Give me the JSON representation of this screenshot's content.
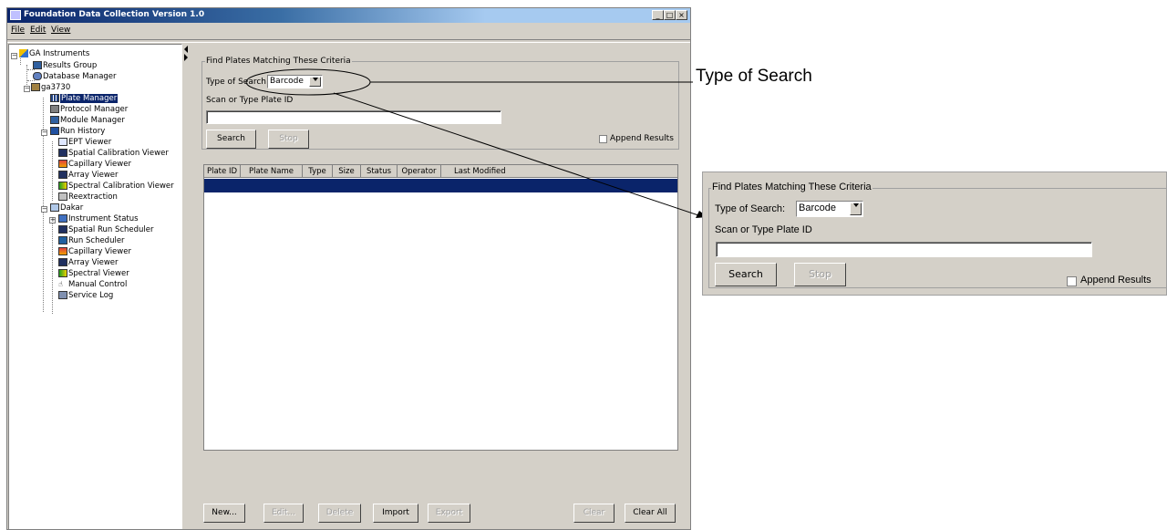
{
  "window": {
    "title": "Foundation Data Collection Version 1.0",
    "controls": [
      "_",
      "□",
      "×"
    ]
  },
  "menu": [
    "File",
    "Edit",
    "View"
  ],
  "tree": {
    "root": "GA Instruments",
    "items": [
      {
        "label": "Results Group",
        "icon": "results-group-icon"
      },
      {
        "label": "Database Manager",
        "icon": "database-icon"
      },
      {
        "label": "ga3730",
        "icon": "instrument-icon"
      },
      {
        "label": "Plate Manager",
        "icon": "grid-icon",
        "selected": true
      },
      {
        "label": "Protocol Manager",
        "icon": "protocol-icon"
      },
      {
        "label": "Module Manager",
        "icon": "module-icon"
      },
      {
        "label": "Run History",
        "icon": "run-history-icon"
      },
      {
        "label": "EPT Viewer",
        "icon": "chart-icon"
      },
      {
        "label": "Spatial Calibration Viewer",
        "icon": "spatial-icon"
      },
      {
        "label": "Capillary Viewer",
        "icon": "capillary-icon"
      },
      {
        "label": "Array Viewer",
        "icon": "array-icon"
      },
      {
        "label": "Spectral Calibration Viewer",
        "icon": "spectral-icon"
      },
      {
        "label": "Reextraction",
        "icon": "reextraction-icon"
      },
      {
        "label": "Dakar",
        "icon": "instrument-icon"
      },
      {
        "label": "Instrument Status",
        "icon": "status-icon"
      },
      {
        "label": "Spatial Run Scheduler",
        "icon": "spatial-icon"
      },
      {
        "label": "Run Scheduler",
        "icon": "scheduler-icon"
      },
      {
        "label": "Capillary Viewer",
        "icon": "capillary-icon"
      },
      {
        "label": "Array Viewer",
        "icon": "array-icon"
      },
      {
        "label": "Spectral Viewer",
        "icon": "spectral-icon"
      },
      {
        "label": "Manual Control",
        "icon": "hand-icon"
      },
      {
        "label": "Service Log",
        "icon": "log-icon"
      }
    ]
  },
  "search": {
    "group_title": "Find Plates Matching These Criteria",
    "type_label": "Type of Search:",
    "type_value": "Barcode",
    "scan_label": "Scan or Type Plate ID",
    "plate_id_value": "",
    "search_button": "Search",
    "stop_button": "Stop",
    "append_label": "Append Results",
    "append_checked": false
  },
  "table": {
    "columns": [
      "Plate ID",
      "Plate Name",
      "Type",
      "Size",
      "Status",
      "Operator",
      "Last Modified"
    ]
  },
  "buttons": {
    "new": "New...",
    "edit": "Edit...",
    "delete": "Delete",
    "import": "Import",
    "export": "Export",
    "clear": "Clear",
    "clear_all": "Clear All"
  },
  "callout": {
    "label": "Type of Search"
  },
  "colors": {
    "selection": "#0a246a",
    "panel": "#d4d0c8"
  }
}
